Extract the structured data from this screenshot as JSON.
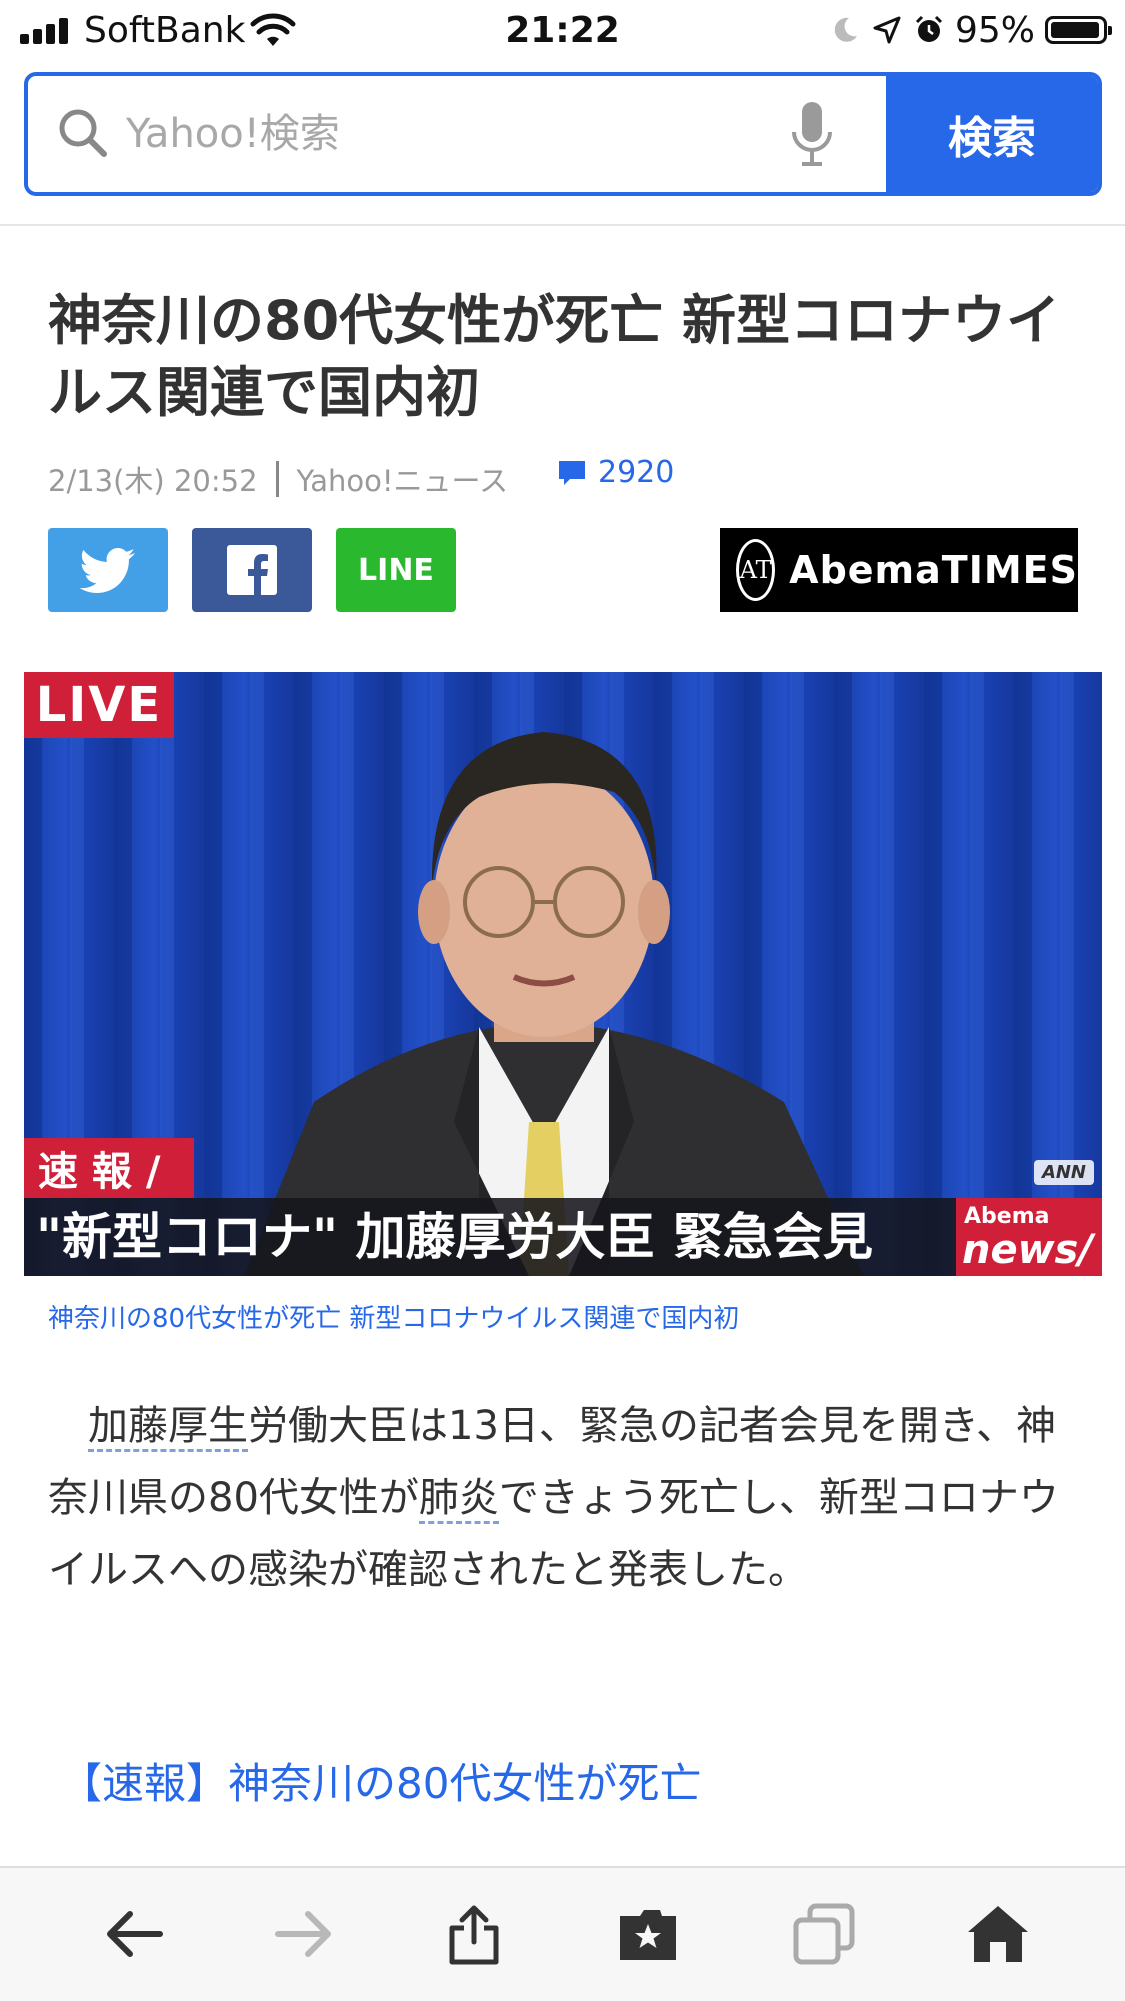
{
  "status_bar": {
    "carrier": "SoftBank",
    "time": "21:22",
    "battery": "95%",
    "battery_level": 0.95
  },
  "search": {
    "placeholder": "Yahoo!検索",
    "button_label": "検索"
  },
  "article": {
    "title": "神奈川の80代女性が死亡 新型コロナウイルス関連で国内初",
    "date": "2/13(木) 20:52",
    "source": "Yahoo!ニュース",
    "comment_count": "2920",
    "share": {
      "line_label": "LINE"
    },
    "publisher_logo": "AbemaTIMES",
    "photo": {
      "live_label": "LIVE",
      "breaking_label": "速 報 /",
      "ticker_text": "\"新型コロナ\" 加藤厚労大臣 緊急会見",
      "abema_news_top": "Abema",
      "abema_news_bottom": "news/",
      "ann_label": "ANN"
    },
    "caption": "神奈川の80代女性が死亡 新型コロナウイルス関連で国内初",
    "body": {
      "indent": "　",
      "kw1": "加藤厚生",
      "seg1": "労働大臣は13日、緊急の記者会見を開き、神奈川県の80代女性が",
      "kw2": "肺炎",
      "seg2": "できょう死亡し、新型コロナウイルスへの感染が確認されたと発表した。"
    },
    "related_link": "【速報】神奈川の80代女性が死亡"
  },
  "toolbar": {
    "items": [
      "back-icon",
      "forward-icon",
      "share-icon",
      "bookmark-icon",
      "tabs-icon",
      "home-icon"
    ]
  },
  "colors": {
    "accent": "#2668e8",
    "twitter": "#43a0e6",
    "facebook": "#3b5998",
    "line": "#2ab92e",
    "live_red": "#d01f38"
  }
}
